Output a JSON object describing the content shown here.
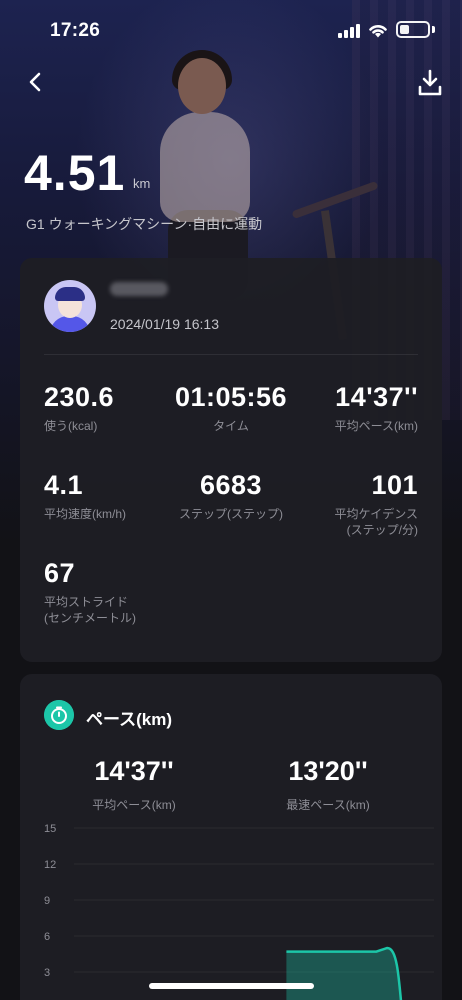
{
  "status_bar": {
    "time": "17:26",
    "signal_bars": 4,
    "battery_level": 0.35
  },
  "header": {
    "back_icon": "chevron-left-icon",
    "download_icon": "download-icon"
  },
  "summary": {
    "distance_value": "4.51",
    "distance_unit": "km",
    "device_mode": "G1 ウォーキングマシーン·自由に運動"
  },
  "user": {
    "datetime": "2024/01/19 16:13"
  },
  "stats": [
    {
      "value": "230.6",
      "label": "使う(kcal)"
    },
    {
      "value": "01:05:56",
      "label": "タイム"
    },
    {
      "value": "14'37''",
      "label": "平均ペース(km)"
    },
    {
      "value": "4.1",
      "label": "平均速度(km/h)"
    },
    {
      "value": "6683",
      "label": "ステップ(ステップ)"
    },
    {
      "value": "101",
      "label": "平均ケイデンス\n(ステップ/分)"
    },
    {
      "value": "67",
      "label": "平均ストライド\n(センチメートル)"
    }
  ],
  "pace": {
    "title": "ペース(km)",
    "avg_value": "14'37''",
    "avg_label": "平均ペース(km)",
    "best_value": "13'20''",
    "best_label": "最速ペース(km)"
  },
  "chart_data": {
    "type": "area",
    "y_ticks": [
      15,
      12,
      9,
      6,
      3
    ],
    "ylim": [
      0,
      15
    ],
    "grid": true,
    "series_color": "#1cc6a8",
    "points": [
      {
        "x": 0.59,
        "y": 4.7
      },
      {
        "x": 0.84,
        "y": 4.7
      },
      {
        "x": 0.87,
        "y": 5.0
      },
      {
        "x": 0.92,
        "y": 0
      }
    ]
  },
  "colors": {
    "accent": "#1cc6a8",
    "card": "#1e1e24",
    "background": "#121216"
  }
}
